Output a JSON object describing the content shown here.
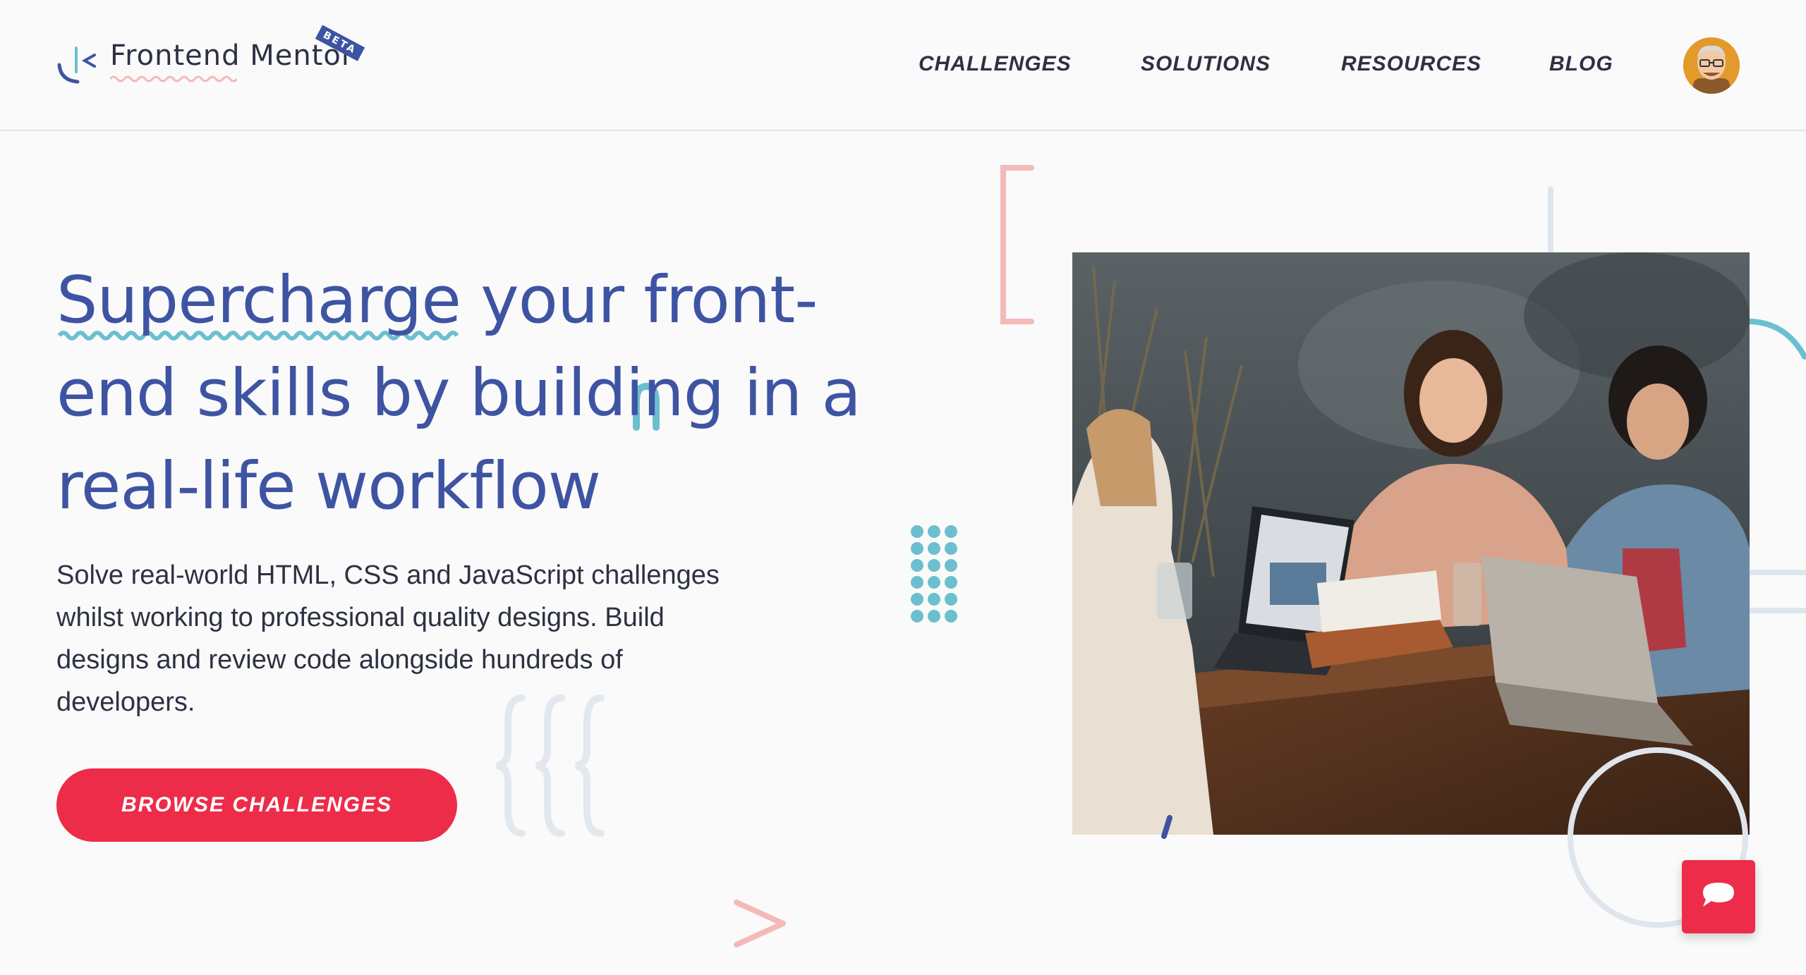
{
  "brand": {
    "name": "Frontend Mentor",
    "badge": "BETA"
  },
  "nav": {
    "items": [
      {
        "label": "CHALLENGES"
      },
      {
        "label": "SOLUTIONS"
      },
      {
        "label": "RESOURCES"
      },
      {
        "label": "BLOG"
      }
    ]
  },
  "hero": {
    "title": "Supercharge your front-end skills by building in a real-life workflow",
    "description": "Solve real-world HTML, CSS and JavaScript challenges whilst working to professional quality designs. Build designs and review code alongside hundreds of developers.",
    "cta_label": "BROWSE CHALLENGES"
  },
  "icons": {
    "logo": "frontend-mentor-logo-icon",
    "avatar": "user-avatar",
    "chat": "chat-bubble-icon"
  },
  "colors": {
    "primary": "#3e54a3",
    "accent": "#ed2c49",
    "teal": "#6cbfcf",
    "pink": "#f4b9b9",
    "text": "#2d3142",
    "background": "#fafafa"
  }
}
